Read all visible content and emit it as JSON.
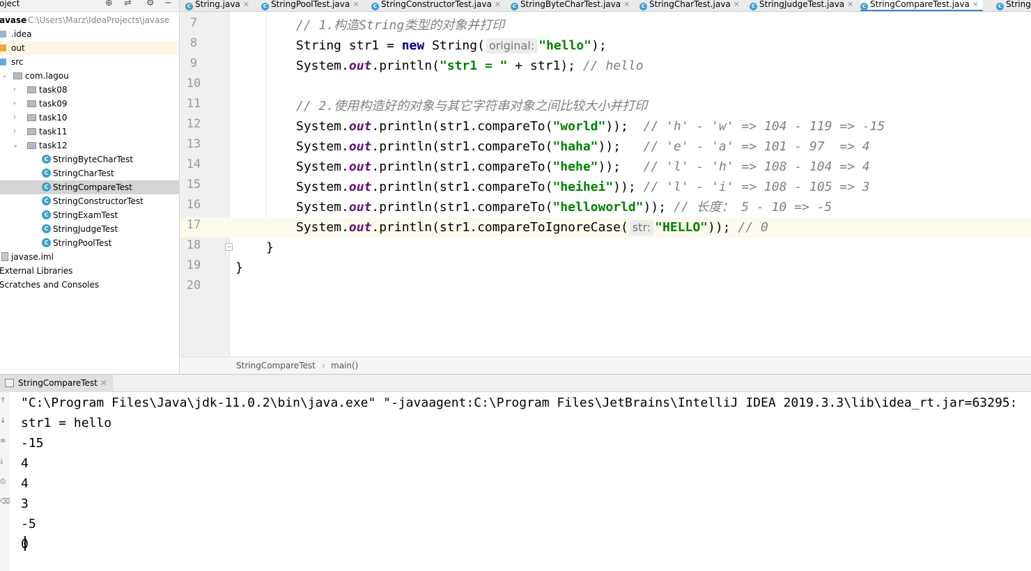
{
  "project_panel": {
    "title": "oject",
    "root": {
      "name": "avase",
      "path": "C:\\Users\\Marz\\IdeaProjects\\javase"
    },
    "items": [
      {
        "label": ".idea",
        "kind": "folder"
      },
      {
        "label": "out",
        "kind": "folder-out"
      },
      {
        "label": "src",
        "kind": "folder-src"
      },
      {
        "label": "com.lagou",
        "kind": "package"
      },
      {
        "label": "task08",
        "kind": "package"
      },
      {
        "label": "task09",
        "kind": "package"
      },
      {
        "label": "task10",
        "kind": "package"
      },
      {
        "label": "task11",
        "kind": "package"
      },
      {
        "label": "task12",
        "kind": "package"
      },
      {
        "label": "StringByteCharTest",
        "kind": "class"
      },
      {
        "label": "StringCharTest",
        "kind": "class"
      },
      {
        "label": "StringCompareTest",
        "kind": "class",
        "selected": true
      },
      {
        "label": "StringConstructorTest",
        "kind": "class"
      },
      {
        "label": "StringExamTest",
        "kind": "class"
      },
      {
        "label": "StringJudgeTest",
        "kind": "class"
      },
      {
        "label": "StringPoolTest",
        "kind": "class"
      },
      {
        "label": "javase.iml",
        "kind": "file"
      },
      {
        "label": "External Libraries",
        "kind": "text"
      },
      {
        "label": "Scratches and Consoles",
        "kind": "text"
      }
    ]
  },
  "editor_tabs": [
    {
      "label": "String.java"
    },
    {
      "label": "StringPoolTest.java"
    },
    {
      "label": "StringConstructorTest.java"
    },
    {
      "label": "StringByteCharTest.java"
    },
    {
      "label": "StringCharTest.java"
    },
    {
      "label": "StringJudgeTest.java"
    },
    {
      "label": "StringCompareTest.java",
      "active": true
    },
    {
      "label": "String"
    }
  ],
  "editor": {
    "line_numbers": [
      "7",
      "8",
      "9",
      "10",
      "11",
      "12",
      "13",
      "14",
      "15",
      "16",
      "17",
      "18",
      "19",
      "20"
    ],
    "current_line": "17",
    "code": {
      "l7": {
        "comment": "// 1.构造String类型的对象并打印"
      },
      "l8": {
        "t1": "String str1 = ",
        "kw": "new",
        "t2": " String(",
        "hint": "original:",
        "str": "\"hello\"",
        "t3": ");"
      },
      "l9": {
        "t1": "System.",
        "fld": "out",
        "t2": ".println(",
        "str": "\"str1 = \"",
        "t3": " + str1); ",
        "comment": "// hello"
      },
      "l11": {
        "comment": "// 2.使用构造好的对象与其它字符串对象之间比较大小并打印"
      },
      "l12": {
        "t1": "System.",
        "fld": "out",
        "t2": ".println(str1.compareTo(",
        "str": "\"world\"",
        "t3": "));  ",
        "comment": "// 'h' - 'w' => 104 - 119 => -15"
      },
      "l13": {
        "t1": "System.",
        "fld": "out",
        "t2": ".println(str1.compareTo(",
        "str": "\"haha\"",
        "t3": "));   ",
        "comment": "// 'e' - 'a' => 101 - 97  => 4"
      },
      "l14": {
        "t1": "System.",
        "fld": "out",
        "t2": ".println(str1.compareTo(",
        "str": "\"hehe\"",
        "t3": "));   ",
        "comment": "// 'l' - 'h' => 108 - 104 => 4"
      },
      "l15": {
        "t1": "System.",
        "fld": "out",
        "t2": ".println(str1.compareTo(",
        "str": "\"heihei\"",
        "t3": ")); ",
        "comment": "// 'l' - 'i' => 108 - 105 => 3"
      },
      "l16": {
        "t1": "System.",
        "fld": "out",
        "t2": ".println(str1.compareTo(",
        "str": "\"helloworld\"",
        "t3": ")); ",
        "comment": "// 长度： 5 - 10 => -5"
      },
      "l17": {
        "t1": "System.",
        "fld": "out",
        "t2": ".println(str1.compareToIgnoreCase(",
        "hint": "str:",
        "str": "\"HELLO\"",
        "t3": ")); ",
        "comment": "// 0"
      },
      "l18": {
        "t1": "}"
      },
      "l19": {
        "t1": "}"
      }
    }
  },
  "breadcrumb": {
    "class": "StringCompareTest",
    "separator": "›",
    "method": "main()"
  },
  "run_panel": {
    "tab_label": "StringCompareTest",
    "output": [
      "\"C:\\Program Files\\Java\\jdk-11.0.2\\bin\\java.exe\" \"-javaagent:C:\\Program Files\\JetBrains\\IntelliJ IDEA 2019.3.3\\lib\\idea_rt.jar=63295:",
      "str1 = hello",
      "-15",
      "4",
      "4",
      "3",
      "-5",
      "0"
    ]
  },
  "colors": {
    "keyword": "#000080",
    "string": "#008000",
    "field": "#660e7a",
    "comment": "#808080",
    "active_tab_underline": "#4083c9"
  }
}
